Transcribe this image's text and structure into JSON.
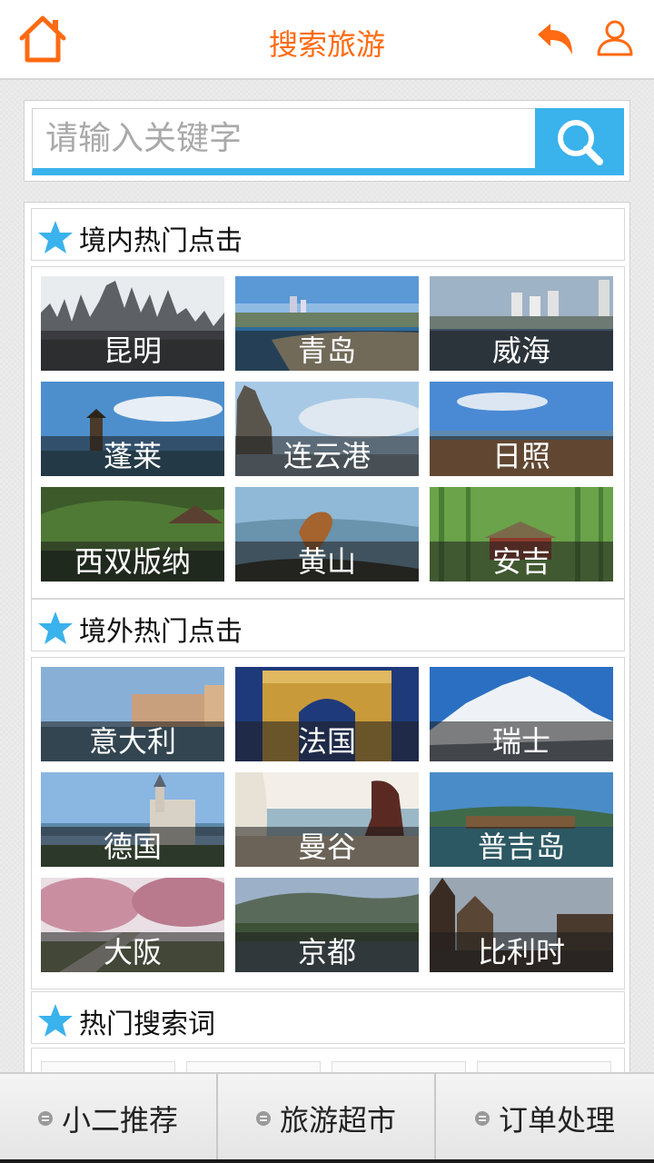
{
  "header": {
    "title": "搜索旅游"
  },
  "search": {
    "placeholder": "请输入关键字"
  },
  "sections": {
    "domestic": {
      "title": "境内热门点击",
      "items": [
        {
          "label": "昆明"
        },
        {
          "label": "青岛"
        },
        {
          "label": "威海"
        },
        {
          "label": "蓬莱"
        },
        {
          "label": "连云港"
        },
        {
          "label": "日照"
        },
        {
          "label": "西双版纳"
        },
        {
          "label": "黄山"
        },
        {
          "label": "安吉"
        }
      ]
    },
    "overseas": {
      "title": "境外热门点击",
      "items": [
        {
          "label": "意大利"
        },
        {
          "label": "法国"
        },
        {
          "label": "瑞士"
        },
        {
          "label": "德国"
        },
        {
          "label": "曼谷"
        },
        {
          "label": "普吉岛"
        },
        {
          "label": "大阪"
        },
        {
          "label": "京都"
        },
        {
          "label": "比利时"
        }
      ]
    },
    "hotwords": {
      "title": "热门搜索词"
    }
  },
  "bottom_nav": {
    "items": [
      {
        "label": "小二推荐"
      },
      {
        "label": "旅游超市"
      },
      {
        "label": "订单处理"
      }
    ]
  },
  "colors": {
    "accent": "#ff6a12",
    "blue": "#3ab2ec"
  }
}
